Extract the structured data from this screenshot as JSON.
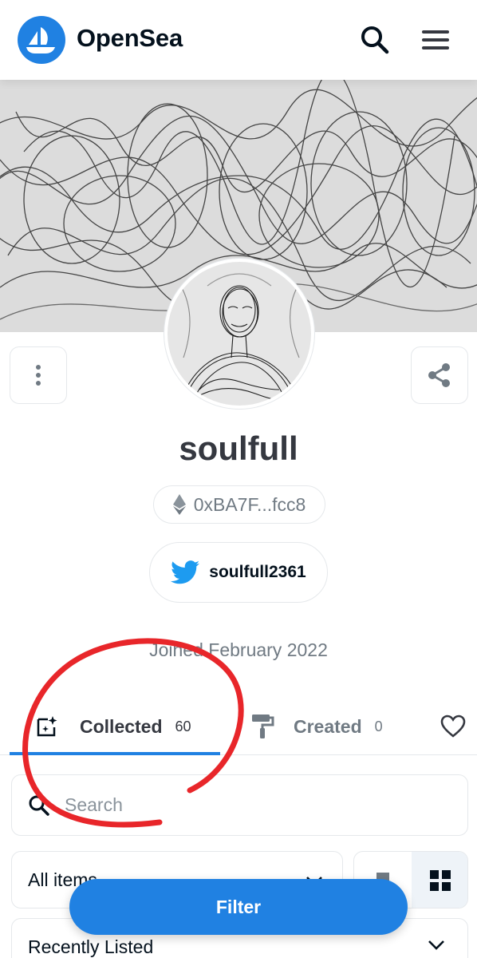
{
  "header": {
    "brand": "OpenSea",
    "search_icon": "search-icon",
    "menu_icon": "hamburger-menu-icon",
    "accent": "#2081e2"
  },
  "profile": {
    "username": "soulfull",
    "address": "0xBA7F...fcc8",
    "twitter": "soulfull2361",
    "joined": "Joined February 2022"
  },
  "tabs": [
    {
      "label": "Collected",
      "count": "60",
      "active": true
    },
    {
      "label": "Created",
      "count": "0",
      "active": false
    }
  ],
  "search": {
    "placeholder": "Search"
  },
  "filters": {
    "items_select": "All items",
    "sort_select": "Recently Listed",
    "filter_button": "Filter"
  },
  "colors": {
    "accent": "#2081e2",
    "annotation": "#e8262a",
    "text_muted": "#707a83"
  }
}
